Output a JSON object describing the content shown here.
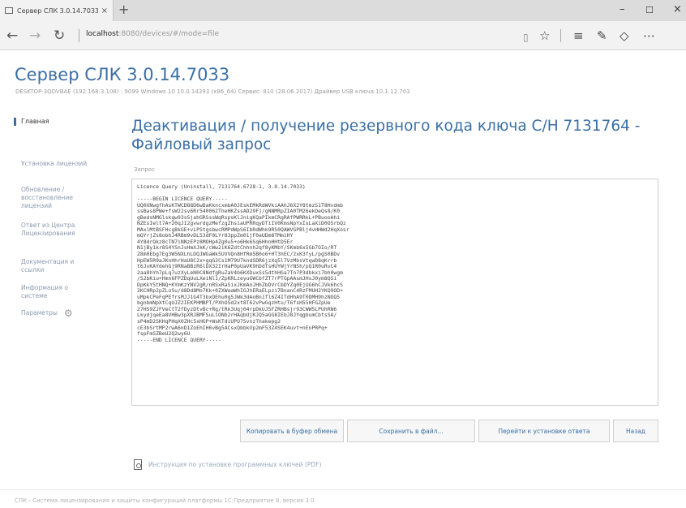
{
  "browser": {
    "tab_title": "Сервер СЛК 3.0.14.7033",
    "tab_close": "×",
    "new_tab": "+",
    "url_host": "localhost",
    "url_rest": ":8080/devices/#/mode=file",
    "win_min": "–",
    "win_max": "☐",
    "win_close": "×"
  },
  "app": {
    "title": "Сервер СЛК 3.0.14.7033",
    "info": "DESKTOP-3QDVBAE (192.168.3.108) : 9099   Windows 10 10.0.14393 (x86_64)   Сервис: 810 (28.06.2017)   Драйвер USB ключа 10.1.12.703"
  },
  "sidebar": {
    "items": [
      {
        "label": "Главная"
      },
      {
        "label": "Установка лицензий"
      },
      {
        "label": "Обновление / восстановление лицензий"
      },
      {
        "label": "Ответ из Центра Лицензирования"
      },
      {
        "label": "Документация и ссылки"
      },
      {
        "label": "Информация о системе"
      },
      {
        "label": "Параметры"
      }
    ]
  },
  "main": {
    "title": "Деактивация / получение резервного кода ключа С/Н 7131764 - Файловый запрос",
    "request_label": "Запрос",
    "request_text": "Licence Query (Uninstall, 7131764.6728-1, 3.0.14.7033)\n\n-----BEGIN LICENCE QUERY-----\nUQ0XNwgfhAsKTWCD88D6wDaKkncxmbA0JEskEMkRdWVkiAAhJ6X2Y8tmzS1T8Hvdmb\nssBas8PWe+fsW22sv6Rr540062TheHKZssAD29Fj/gNNMRpZIA0TM26ekOeQs8/K0\ngBedsNMGlskgw93sSjahGRSssWqRspsKlJnigKQaPIkmCRgRAfPWRRkL+PBuooAhi\nNZEsIelt7A+20qJI2gvwrdgzMefzgZhsiaUPRRqyDTiIV0KmsNpYxIxLaXiD0OSrbQz\nMAxlMtBSFHcg8kGE+vLPStgsbwcRMPdWpS6IbRdWhk9RS0QAWVGPBlj4vHHWd2HqXosr\nmQYrjZs8obhJ4RBm9vDL53dF0LYr83ppZm01jF0aUDm8TMmiHY\n4Y8drQkz8cTN7iNNzEPz8MOHp4Zg0u5+o6Hk6Sq6HhnHHtD5Er\nN1jBy1kr8S4YSnJsHmXJkK/cWw2iK6ZdtChhnh2qf8yKMbY/SKmb6x5Gb7OIo/RT\nZ8m0Ebg7Eg3W5NXLhLDQJWGaWk5UVVQn8HfRm5B0o6+HT3hEC/2xK3fyL/pgS0BDv\nHpEW5R9aJKnHhrHaU8C2x+gqG2Cs1M79U7kndSDR6jzXq5l7VzMbsVtqwD8qKrrb\nt6JvKAYdehGj9RNaBBzR6lDX32IrHaP0pUaVK9hDdTsHUYWjYrN5h/pQ1R0uRvC4\n2aa8hYh7pLq7uzXyLeN0C8NdfgRuZaV4b6KXDuxSs5dthHGa7Tn7P3dbkxi7bh0wgm\n/S2bKiu+Hmn6FPZDqUuLXeiNl1/ZpKRLzeyuGWCbfZT7rPTGpAAsmJHsJ0ym8QSi\nDpKkY5tHNQ+KYmKzYNV2gR/nRSxRaSixJKmAnJHhZbDVrCbDYZq0EjUG6hCJVk6hcS\n2KCHRp2pZLoSu/d8Dd8Mo7Kk+0ZXWaaWhIGJhERaELpzi7BnanC4RzFMUH2YKQ9OD+\nuMpkCPeFqPEfrsMJJ1G4T3bxDEhu0g5JWk3dAoBn1fl6Z4ITdHhA9T0DMH9hzNOQ5\nbgnbmNpXtCqUJZ2IEKPHMBPT/PXhOSd2xt8T62vPwGqzHtu/T6fsH55HFGZpUe\n27HS9ZJFVeCtT2fDyzDtvBc+Rg/tRk3Uqj04rpDkUJ5FZRHBsjr93CWW5LPUhRN6\nLkydjqeEa8VHBw3pXRJBMFSuLiONb2rHAqbUjKJQ5aGG8IEbJ8JYqgbumCbtsSA/\nsP4mD2SKHqPHqX0ZHc5xHGP+WsKTdiUPO7SvnzThakepg2\ncE3bSrtMP2rwA6nD1ZoEhIH6vBg5ACsxQbbkVp2mF53Z4SEK4uvt+nEnPRPq+\nfspFmSZBeU2Q2wy6U\n-----END LICENCE QUERY-----",
    "buttons": {
      "copy": "Копировать в буфер обмена",
      "save": "Сохранить в файл...",
      "go_install": "Перейти к установке ответа",
      "back": "Назад"
    },
    "pdf_link": "Инструкция по установке программных ключей (PDF)"
  },
  "footer": {
    "text": "СЛК - Система лицензирования и защиты конфигураций платформы 1С:Предприятие 8, версия 3.0"
  }
}
